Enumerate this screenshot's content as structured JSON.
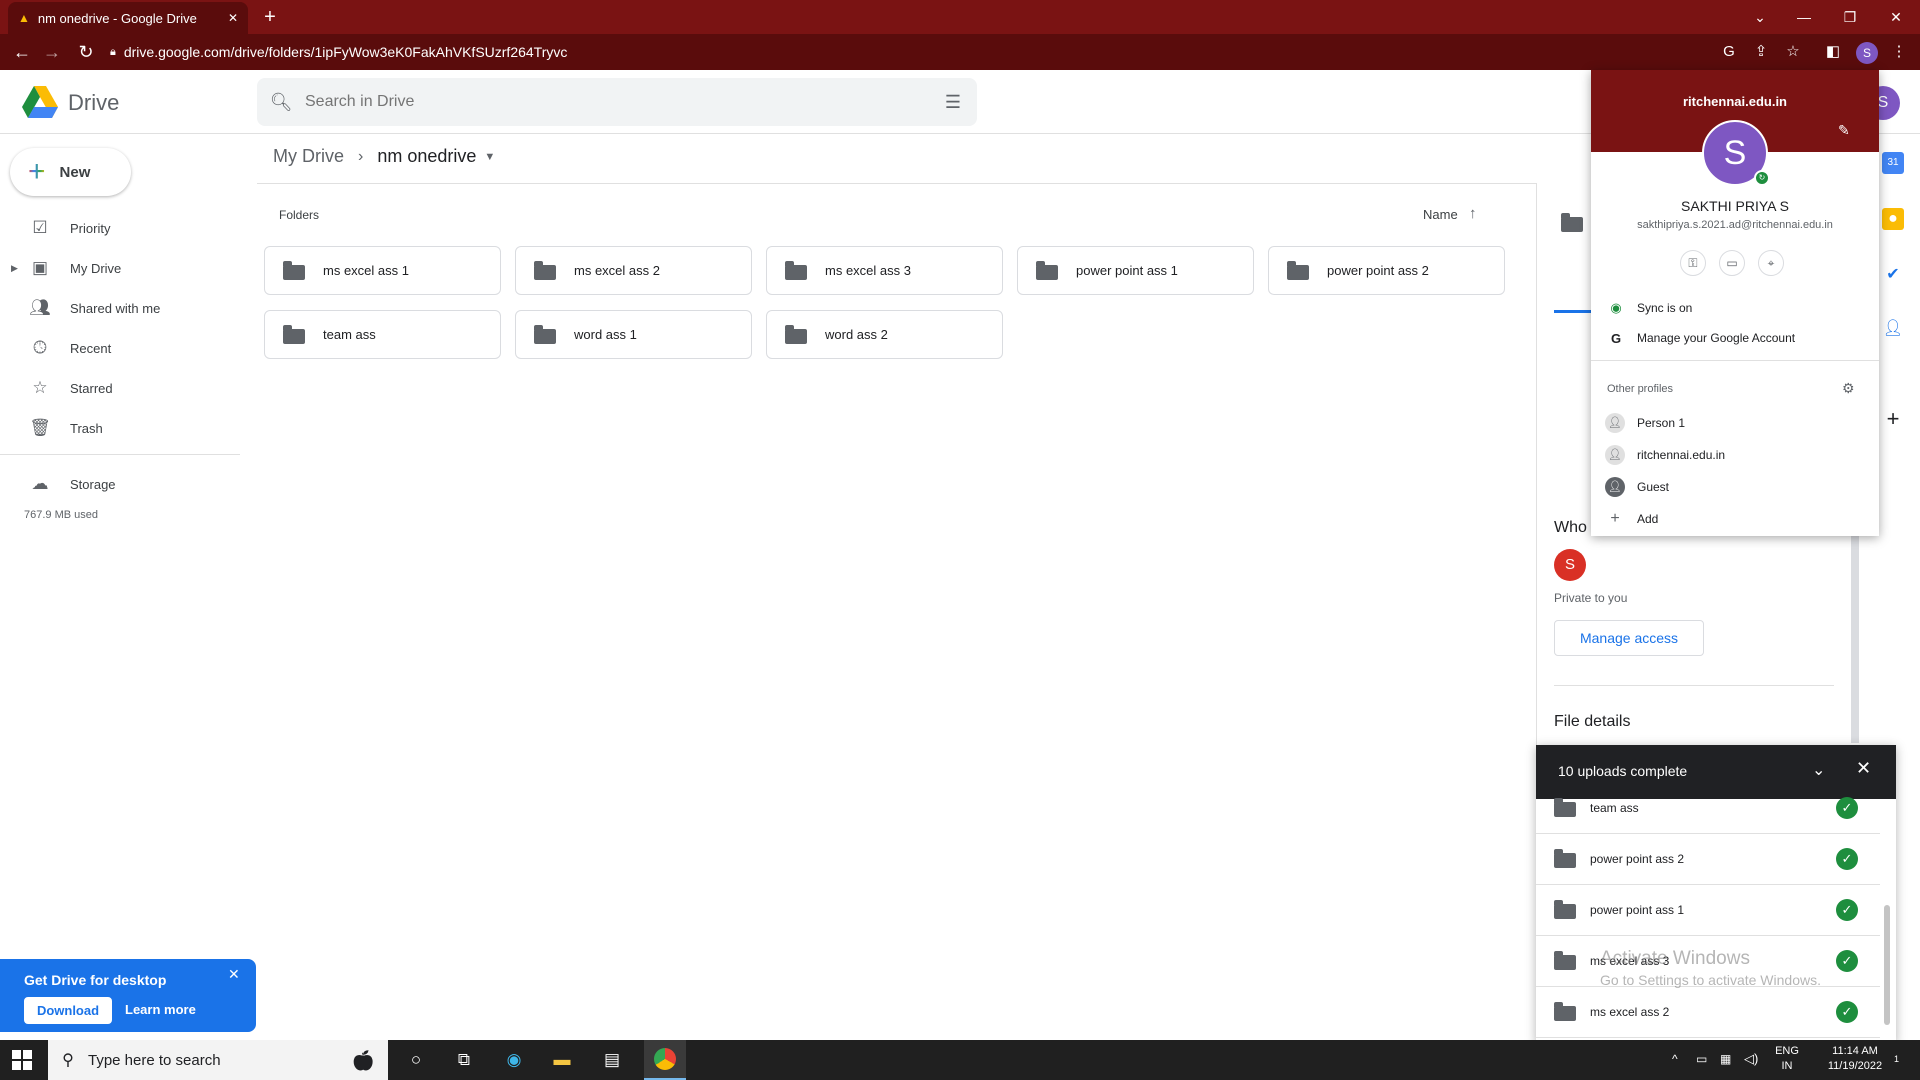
{
  "browser": {
    "tab_title": "nm onedrive - Google Drive",
    "tab_close": "✕",
    "new_tab": "+",
    "url": "drive.google.com/drive/folders/1ipFyWow3eK0FakAhVKfSUzrf264Tryvc",
    "profile_initial": "S",
    "window_controls": [
      "⌄",
      "—",
      "❐",
      "✕"
    ]
  },
  "drive": {
    "app_name": "Drive",
    "search_placeholder": "Search in Drive",
    "user_initial": "S"
  },
  "nav": {
    "new_label": "New",
    "items": [
      {
        "label": "Priority",
        "icon": "priority-icon"
      },
      {
        "label": "My Drive",
        "icon": "my-drive-icon"
      },
      {
        "label": "Shared with me",
        "icon": "shared-icon"
      },
      {
        "label": "Recent",
        "icon": "clock-icon"
      },
      {
        "label": "Starred",
        "icon": "star-icon"
      },
      {
        "label": "Trash",
        "icon": "trash-icon"
      },
      {
        "label": "Storage",
        "icon": "cloud-icon"
      }
    ],
    "storage_used": "767.9 MB used"
  },
  "breadcrumb": {
    "root": "My Drive",
    "current": "nm onedrive"
  },
  "folders_section": {
    "label": "Folders",
    "sort_label": "Name",
    "items": [
      "ms excel ass 1",
      "ms excel ass 2",
      "ms excel ass 3",
      "power point ass 1",
      "power point ass 2",
      "team ass",
      "word ass 1",
      "word ass 2"
    ]
  },
  "details": {
    "who_label": "Who",
    "owner_initial": "S",
    "private_text": "Private to you",
    "manage_access": "Manage access",
    "file_details": "File details"
  },
  "profile_menu": {
    "org": "ritchennai.edu.in",
    "initial": "S",
    "name": "SAKTHI PRIYA S",
    "email": "sakthipriya.s.2021.ad@ritchennai.edu.in",
    "sync": "Sync is on",
    "manage_account": "Manage your Google Account",
    "other_profiles": "Other profiles",
    "profiles": [
      "Person 1",
      "ritchennai.edu.in",
      "Guest"
    ],
    "add": "Add"
  },
  "uploads": {
    "title": "10 uploads complete",
    "items": [
      "team ass",
      "power point ass 2",
      "power point ass 1",
      "ms excel ass 3",
      "ms excel ass 2"
    ]
  },
  "watermark": {
    "title": "Activate Windows",
    "subtitle": "Go to Settings to activate Windows."
  },
  "banner": {
    "title": "Get Drive for desktop",
    "download": "Download",
    "learn_more": "Learn more"
  },
  "taskbar": {
    "search_placeholder": "Type here to search",
    "lang_top": "ENG",
    "lang_bottom": "IN",
    "time": "11:14 AM",
    "date": "11/19/2022",
    "notification_count": "1"
  },
  "colors": {
    "chrome_frame": "#7a1313",
    "accent": "#1a73e8",
    "success": "#1e8e3e",
    "avatar": "#7e57c2"
  }
}
